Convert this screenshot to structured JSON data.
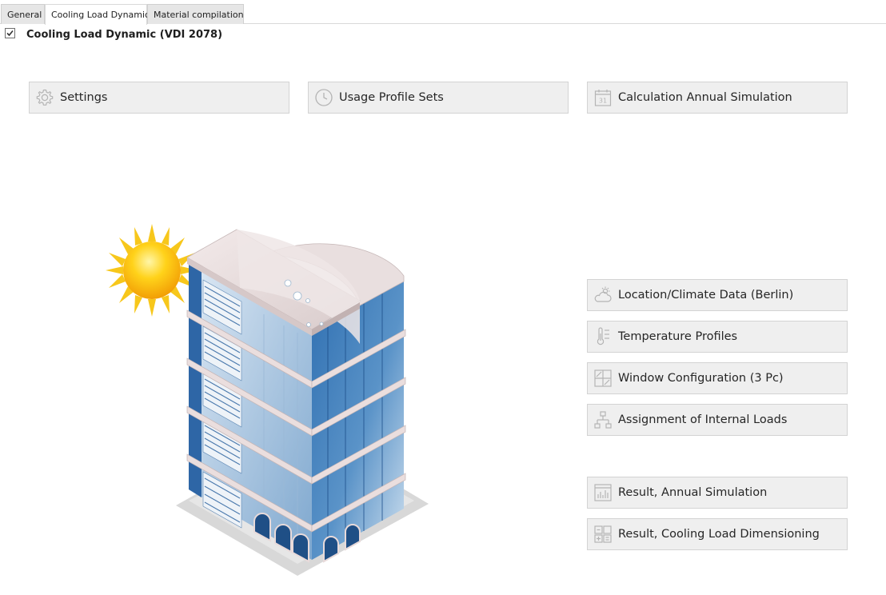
{
  "tabs": [
    {
      "label": "General"
    },
    {
      "label": "Cooling Load Dynamic"
    },
    {
      "label": "Material compilation"
    }
  ],
  "active_tab": "Cooling Load Dynamic",
  "section": {
    "title": "Cooling Load Dynamic (VDI 2078)",
    "checked": true
  },
  "buttons": {
    "settings": {
      "label": "Settings",
      "icon": "gear-icon"
    },
    "usage_profile_sets": {
      "label": "Usage Profile Sets",
      "icon": "clock-icon"
    },
    "calculation_annual_simulation": {
      "label": "Calculation Annual Simulation",
      "icon": "calendar-icon",
      "icon_text": "31"
    },
    "location_climate": {
      "label": "Location/Climate Data (Berlin)",
      "icon": "cloud-sun-icon"
    },
    "temperature_profiles": {
      "label": "Temperature Profiles",
      "icon": "thermometer-icon"
    },
    "window_configuration": {
      "label": "Window Configuration (3 Pc)",
      "icon": "window-icon"
    },
    "internal_loads": {
      "label": "Assignment of Internal Loads",
      "icon": "hierarchy-icon"
    },
    "result_annual": {
      "label": "Result, Annual Simulation",
      "icon": "bar-chart-icon"
    },
    "result_cooling": {
      "label": "Result, Cooling Load Dimensioning",
      "icon": "calculator-icon"
    }
  },
  "illustration": {
    "subject": "office-building-with-sun"
  },
  "colors": {
    "button_bg": "#efefef",
    "button_border": "#d3d3d3",
    "icon": "#b4b4b4",
    "sun": "#f7c71b"
  }
}
